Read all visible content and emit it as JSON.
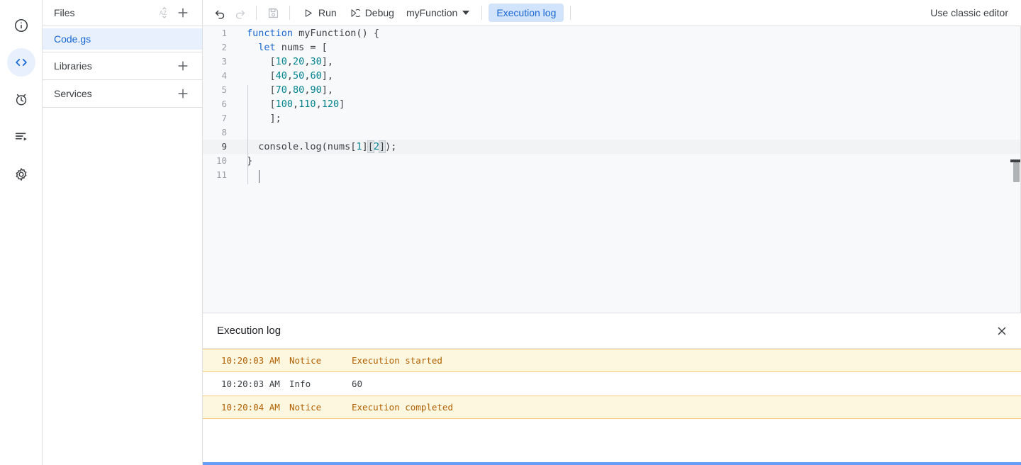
{
  "rail": {
    "items": [
      {
        "name": "overview-icon",
        "label": "Overview",
        "active": false
      },
      {
        "name": "editor-icon",
        "label": "Editor",
        "active": true
      },
      {
        "name": "triggers-icon",
        "label": "Triggers",
        "active": false
      },
      {
        "name": "executions-icon",
        "label": "Executions",
        "active": false
      },
      {
        "name": "settings-icon",
        "label": "Project Settings",
        "active": false
      }
    ]
  },
  "sidebar": {
    "files_header": "Files",
    "sort_icon": "sort-az-icon",
    "add_file_icon": "plus-icon",
    "files": [
      {
        "name": "Code.gs",
        "selected": true
      }
    ],
    "libraries_header": "Libraries",
    "services_header": "Services"
  },
  "toolbar": {
    "undo_icon": "undo-icon",
    "redo_icon": "redo-icon",
    "save_icon": "save-icon",
    "run_label": "Run",
    "debug_label": "Debug",
    "function_selected": "myFunction",
    "execution_log_label": "Execution log",
    "classic_editor_label": "Use classic editor"
  },
  "editor": {
    "active_line": 9,
    "lines": [
      {
        "n": "1",
        "tokens": [
          {
            "t": "function",
            "c": "kw"
          },
          {
            "t": " myFunction() {",
            "c": ""
          }
        ]
      },
      {
        "n": "2",
        "tokens": [
          {
            "t": "  ",
            "c": ""
          },
          {
            "t": "let",
            "c": "kw"
          },
          {
            "t": " nums = [",
            "c": ""
          }
        ]
      },
      {
        "n": "3",
        "tokens": [
          {
            "t": "    [",
            "c": ""
          },
          {
            "t": "10",
            "c": "num"
          },
          {
            "t": ",",
            "c": ""
          },
          {
            "t": "20",
            "c": "num"
          },
          {
            "t": ",",
            "c": ""
          },
          {
            "t": "30",
            "c": "num"
          },
          {
            "t": "],",
            "c": ""
          }
        ]
      },
      {
        "n": "4",
        "tokens": [
          {
            "t": "    [",
            "c": ""
          },
          {
            "t": "40",
            "c": "num"
          },
          {
            "t": ",",
            "c": ""
          },
          {
            "t": "50",
            "c": "num"
          },
          {
            "t": ",",
            "c": ""
          },
          {
            "t": "60",
            "c": "num"
          },
          {
            "t": "],",
            "c": ""
          }
        ]
      },
      {
        "n": "5",
        "tokens": [
          {
            "t": "    [",
            "c": ""
          },
          {
            "t": "70",
            "c": "num"
          },
          {
            "t": ",",
            "c": ""
          },
          {
            "t": "80",
            "c": "num"
          },
          {
            "t": ",",
            "c": ""
          },
          {
            "t": "90",
            "c": "num"
          },
          {
            "t": "],",
            "c": ""
          }
        ]
      },
      {
        "n": "6",
        "tokens": [
          {
            "t": "    [",
            "c": ""
          },
          {
            "t": "100",
            "c": "num"
          },
          {
            "t": ",",
            "c": ""
          },
          {
            "t": "110",
            "c": "num"
          },
          {
            "t": ",",
            "c": ""
          },
          {
            "t": "120",
            "c": "num"
          },
          {
            "t": "]",
            "c": ""
          }
        ]
      },
      {
        "n": "7",
        "tokens": [
          {
            "t": "    ];",
            "c": ""
          }
        ]
      },
      {
        "n": "8",
        "tokens": [
          {
            "t": "",
            "c": ""
          }
        ]
      },
      {
        "n": "9",
        "tokens": [
          {
            "t": "  console.log(nums[",
            "c": ""
          },
          {
            "t": "1",
            "c": "num"
          },
          {
            "t": "]",
            "c": ""
          },
          {
            "t": "[",
            "c": "brk"
          },
          {
            "t": "2",
            "c": "num"
          },
          {
            "t": "]",
            "c": "brk"
          },
          {
            "t": ");",
            "c": ""
          }
        ]
      },
      {
        "n": "10",
        "tokens": [
          {
            "t": "}",
            "c": ""
          }
        ]
      },
      {
        "n": "11",
        "tokens": [
          {
            "t": "",
            "c": ""
          }
        ]
      }
    ]
  },
  "execution_log": {
    "title": "Execution log",
    "close_icon": "close-icon",
    "rows": [
      {
        "time": "10:20:03 AM",
        "severity": "Notice",
        "message": "Execution started",
        "kind": "notice"
      },
      {
        "time": "10:20:03 AM",
        "severity": "Info",
        "message": "60",
        "kind": "info"
      },
      {
        "time": "10:20:04 AM",
        "severity": "Notice",
        "message": "Execution completed",
        "kind": "notice"
      }
    ]
  },
  "colors": {
    "accent_blue": "#1967d2",
    "pill_bg": "#d2e3fc",
    "selected_file_bg": "#e8f0fe",
    "notice_bg": "#fef7e0",
    "notice_text": "#b06000",
    "number_token": "#00838f",
    "progress": "#669df6"
  }
}
